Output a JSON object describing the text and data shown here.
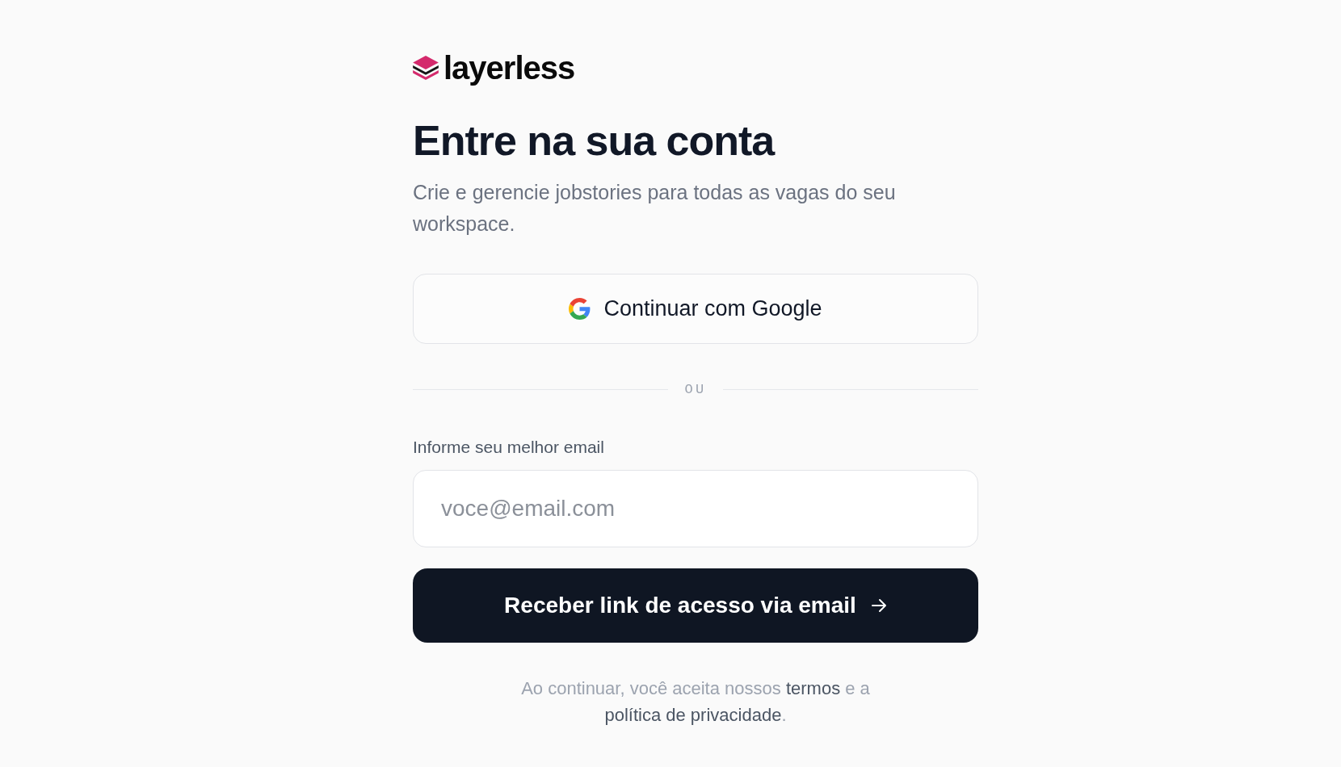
{
  "logo": {
    "text": "layerless"
  },
  "heading": "Entre na sua conta",
  "subtitle": "Crie e gerencie jobstories para todas as vagas do seu workspace.",
  "google_button": {
    "label": "Continuar com Google"
  },
  "divider": {
    "label": "OU"
  },
  "email_field": {
    "label": "Informe seu melhor email",
    "placeholder": "voce@email.com"
  },
  "submit_button": {
    "label": "Receber link de acesso via email"
  },
  "legal": {
    "parts": [
      {
        "kind": "text",
        "text": "Ao continuar, você aceita nossos "
      },
      {
        "kind": "link",
        "text": "termos"
      },
      {
        "kind": "text",
        "text": " e a "
      },
      {
        "kind": "link",
        "text": "política de privacidade"
      },
      {
        "kind": "text",
        "text": "."
      }
    ]
  }
}
